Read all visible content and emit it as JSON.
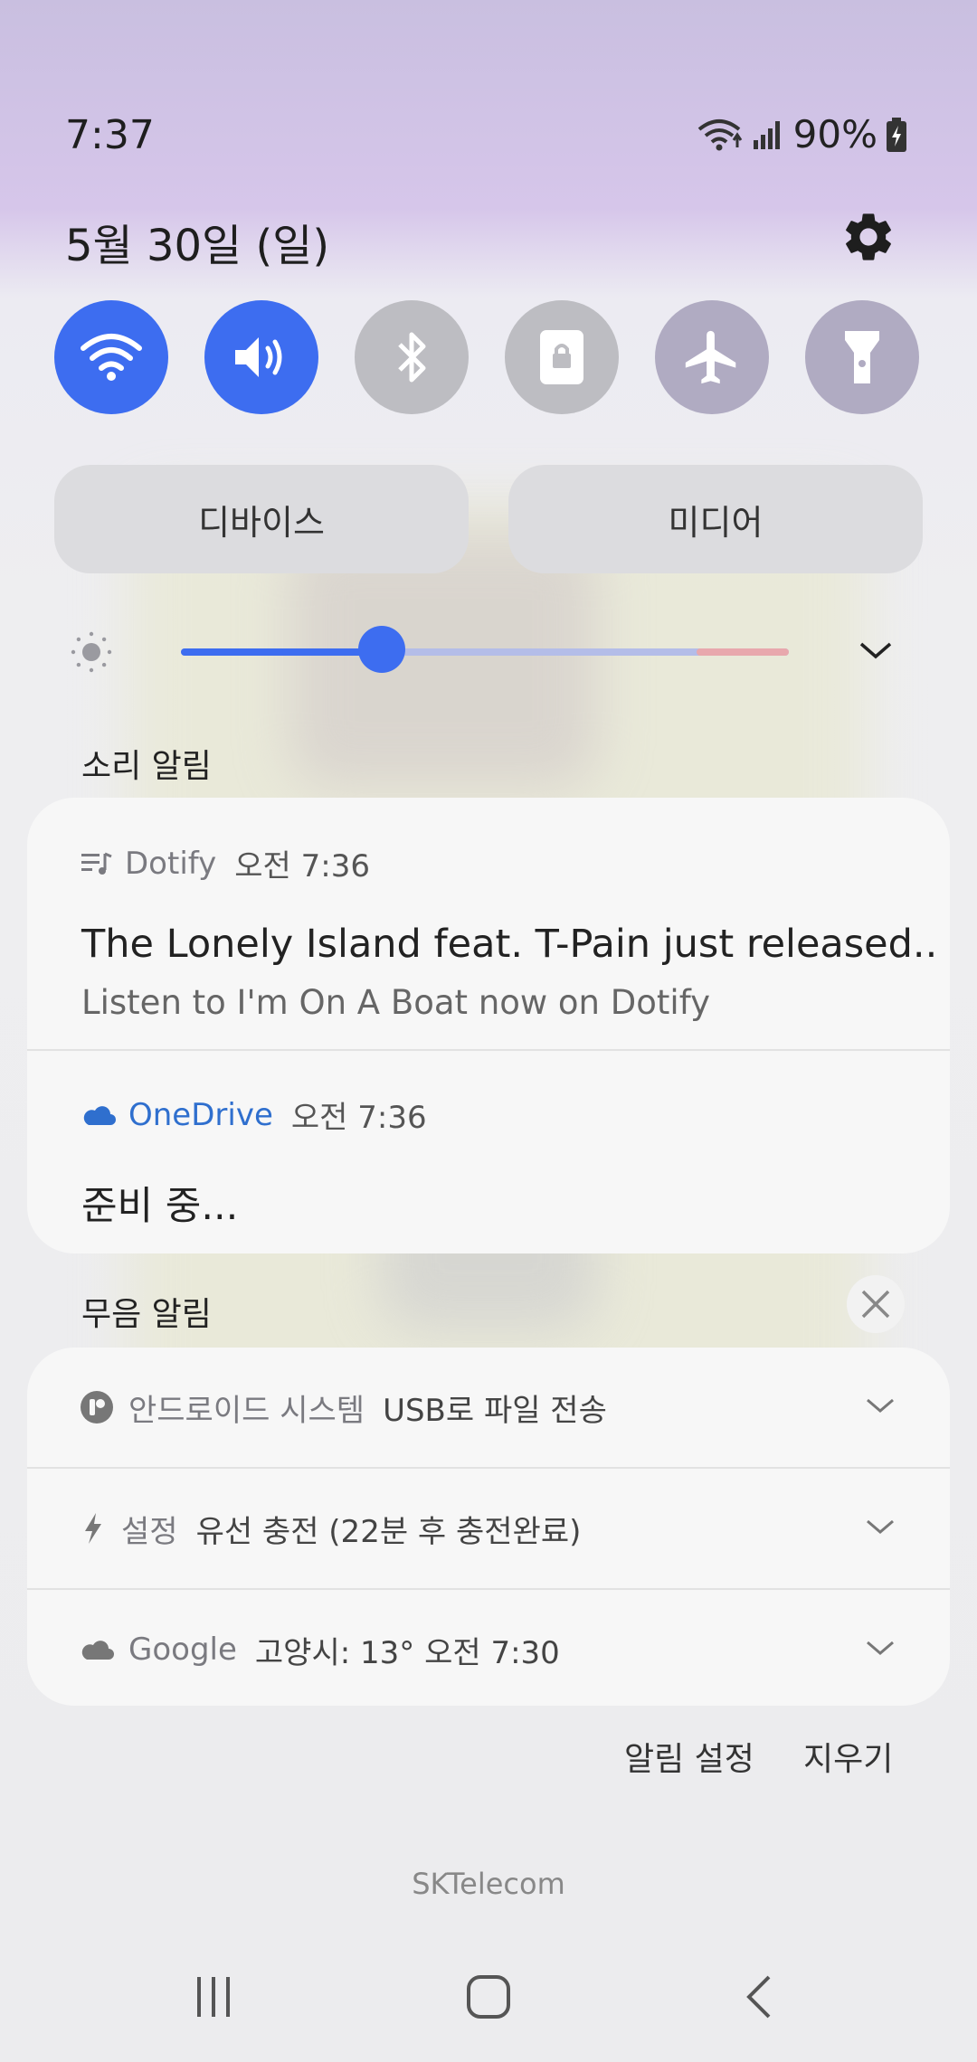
{
  "status": {
    "time": "7:37",
    "battery": "90%"
  },
  "header": {
    "date": "5월 30일 (일)"
  },
  "quick_settings": [
    {
      "name": "wifi",
      "state": "on"
    },
    {
      "name": "sound",
      "state": "on"
    },
    {
      "name": "bluetooth",
      "state": "off"
    },
    {
      "name": "screen-lock",
      "state": "off"
    },
    {
      "name": "airplane-mode",
      "state": "off"
    },
    {
      "name": "flashlight",
      "state": "off"
    }
  ],
  "pills": {
    "devices": "디바이스",
    "media": "미디어"
  },
  "brightness": {
    "level": 0.33
  },
  "sections": {
    "sound_alerts": "소리 알림",
    "silent_alerts": "무음 알림"
  },
  "notifications": [
    {
      "app": "Dotify",
      "time": "오전 7:36",
      "title": "The Lonely Island feat. T-Pain just released..",
      "body": "Listen to I'm On A Boat now on Dotify"
    },
    {
      "app": "OneDrive",
      "time": "오전 7:36",
      "title": "준비 중..."
    }
  ],
  "silent": [
    {
      "app": "안드로이드 시스템",
      "text": "USB로 파일 전송"
    },
    {
      "app": "설정",
      "text": "유선 충전 (22분 후 충전완료)"
    },
    {
      "app": "Google",
      "text": "고양시: 13°  오전 7:30"
    }
  ],
  "actions": {
    "settings": "알림 설정",
    "clear": "지우기"
  },
  "footer": {
    "carrier": "SKTelecom"
  },
  "colors": {
    "accent": "#3d6df0",
    "onedrive": "#2f6fce"
  }
}
